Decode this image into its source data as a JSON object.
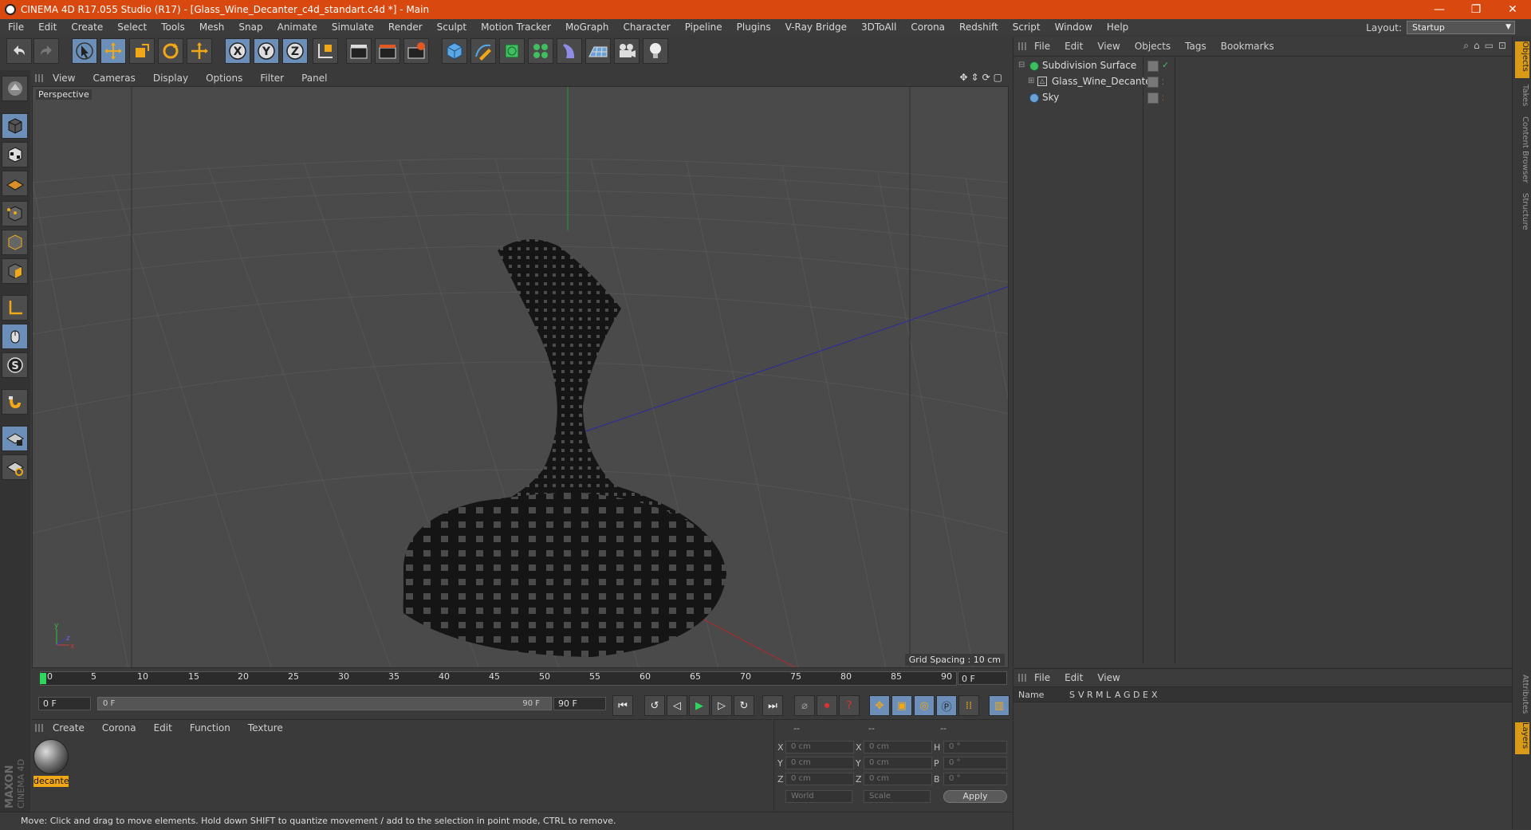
{
  "window": {
    "title": "CINEMA 4D R17.055 Studio (R17) - [Glass_Wine_Decanter_c4d_standart.c4d *] - Main",
    "minimize": "—",
    "restore": "❐",
    "close": "✕"
  },
  "menubar": {
    "items": [
      "File",
      "Edit",
      "Create",
      "Select",
      "Tools",
      "Mesh",
      "Snap",
      "Animate",
      "Simulate",
      "Render",
      "Sculpt",
      "Motion Tracker",
      "MoGraph",
      "Character",
      "Pipeline",
      "Plugins",
      "V-Ray Bridge",
      "3DToAll",
      "Corona",
      "Redshift",
      "Script",
      "Window",
      "Help"
    ],
    "layout_label": "Layout:",
    "layout_value": "Startup"
  },
  "viewport": {
    "menu": [
      "View",
      "Cameras",
      "Display",
      "Options",
      "Filter",
      "Panel"
    ],
    "label": "Perspective",
    "grid_spacing": "Grid Spacing : 10 cm",
    "axis": {
      "y": "y",
      "x": "x",
      "z": "z"
    }
  },
  "timeline": {
    "ticks": [
      "0",
      "5",
      "10",
      "15",
      "20",
      "25",
      "30",
      "35",
      "40",
      "45",
      "50",
      "55",
      "60",
      "65",
      "70",
      "75",
      "80",
      "85",
      "90"
    ],
    "current_frame": "0 F"
  },
  "playback": {
    "start": "0 F",
    "slider_start": "0 F",
    "slider_end": "90 F",
    "end": "90 F"
  },
  "material_manager": {
    "menu": [
      "Create",
      "Corona",
      "Edit",
      "Function",
      "Texture"
    ],
    "material_label": "decante"
  },
  "coordinates": {
    "headers": [
      "--",
      "--",
      "--"
    ],
    "rows": [
      {
        "a": "X",
        "av": "0 cm",
        "b": "X",
        "bv": "0 cm",
        "c": "H",
        "cv": "0 °"
      },
      {
        "a": "Y",
        "av": "0 cm",
        "b": "Y",
        "bv": "0 cm",
        "c": "P",
        "cv": "0 °"
      },
      {
        "a": "Z",
        "av": "0 cm",
        "b": "Z",
        "bv": "0 cm",
        "c": "B",
        "cv": "0 °"
      }
    ],
    "world": "World",
    "scale": "Scale",
    "apply": "Apply"
  },
  "status": "Move: Click and drag to move elements. Hold down SHIFT to quantize movement / add to the selection in point mode, CTRL to remove.",
  "maxon_logo": {
    "maxon": "MAXON",
    "c4d": "CINEMA 4D"
  },
  "object_manager": {
    "menu": [
      "File",
      "Edit",
      "View",
      "Objects",
      "Tags",
      "Bookmarks"
    ],
    "objects": [
      {
        "name": "Subdivision Surface",
        "icon": "subdivision-icon"
      },
      {
        "name": "Glass_Wine_Decanter",
        "icon": "polygon-object-icon"
      },
      {
        "name": "Sky",
        "icon": "sky-icon"
      }
    ]
  },
  "attribute_manager": {
    "menu": [
      "File",
      "Edit",
      "View"
    ],
    "columns": [
      "Name",
      "S",
      "V",
      "R",
      "M",
      "L",
      "A",
      "G",
      "D",
      "E",
      "X"
    ]
  },
  "side_tabs": [
    "Objects",
    "Takes",
    "Content Browser",
    "Structure"
  ],
  "side_tabs_bottom": [
    "Attributes",
    "Layers"
  ],
  "colors": {
    "titlebar": "#d9480f",
    "accent": "#6b8fb8",
    "highlight": "#d99a1a"
  }
}
